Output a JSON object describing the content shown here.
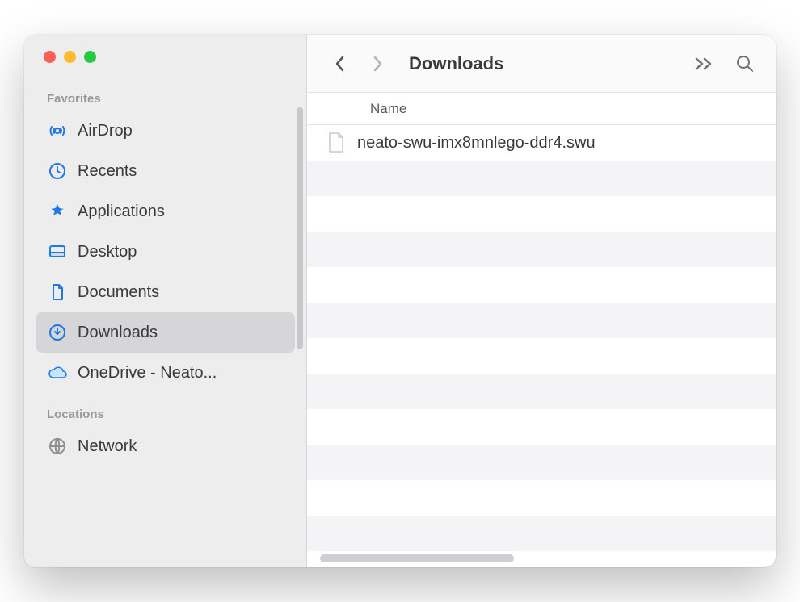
{
  "window": {
    "title": "Downloads"
  },
  "sidebar": {
    "sections": [
      {
        "label": "Favorites",
        "items": [
          {
            "icon": "airdrop",
            "label": "AirDrop",
            "selected": false
          },
          {
            "icon": "recents",
            "label": "Recents",
            "selected": false
          },
          {
            "icon": "applications",
            "label": "Applications",
            "selected": false
          },
          {
            "icon": "desktop",
            "label": "Desktop",
            "selected": false
          },
          {
            "icon": "documents",
            "label": "Documents",
            "selected": false
          },
          {
            "icon": "downloads",
            "label": "Downloads",
            "selected": true
          },
          {
            "icon": "onedrive",
            "label": "OneDrive - Neato...",
            "selected": false
          }
        ]
      },
      {
        "label": "Locations",
        "items": [
          {
            "icon": "network",
            "label": "Network",
            "selected": false
          }
        ]
      }
    ]
  },
  "columns": {
    "name": "Name"
  },
  "files": [
    {
      "name": "neato-swu-imx8mnlego-ddr4.swu"
    }
  ],
  "colors": {
    "accent": "#1f78e6",
    "sidebar_bg": "#eeedee",
    "selected_bg": "#d6d5d7"
  }
}
